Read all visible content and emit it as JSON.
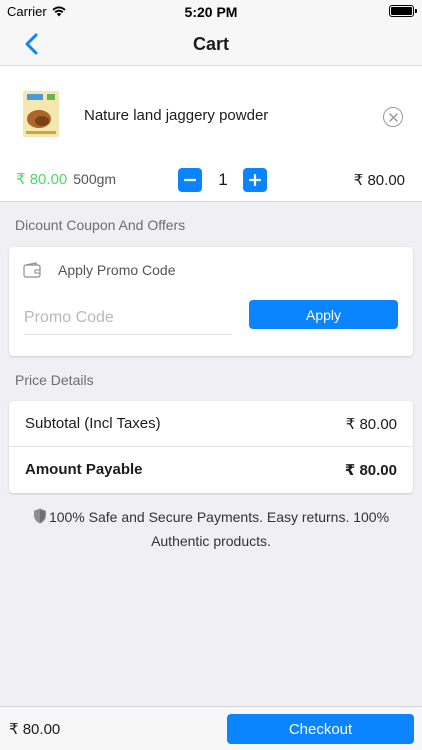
{
  "status_bar": {
    "carrier": "Carrier",
    "time": "5:20 PM"
  },
  "nav": {
    "title": "Cart",
    "back_icon": "chevron-left-icon"
  },
  "cart_item": {
    "name": "Nature land jaggery powder",
    "unit_price": "₹ 80.00",
    "size": "500gm",
    "quantity": "1",
    "line_total": "₹ 80.00"
  },
  "coupon": {
    "section_title": "Dicount Coupon And Offers",
    "label": "Apply Promo Code",
    "placeholder": "Promo Code",
    "value": "",
    "apply_label": "Apply"
  },
  "price_details": {
    "section_title": "Price Details",
    "subtotal_label": "Subtotal (Incl Taxes)",
    "subtotal_value": "₹ 80.00",
    "payable_label": "Amount Payable",
    "payable_value": "₹ 80.00"
  },
  "secure_note": "100% Safe and Secure Payments. Easy returns. 100% Authentic products.",
  "footer": {
    "total": "₹ 80.00",
    "checkout_label": "Checkout"
  },
  "colors": {
    "accent": "#0a84ff",
    "price_green": "#4cd964",
    "background": "#efeff4"
  }
}
